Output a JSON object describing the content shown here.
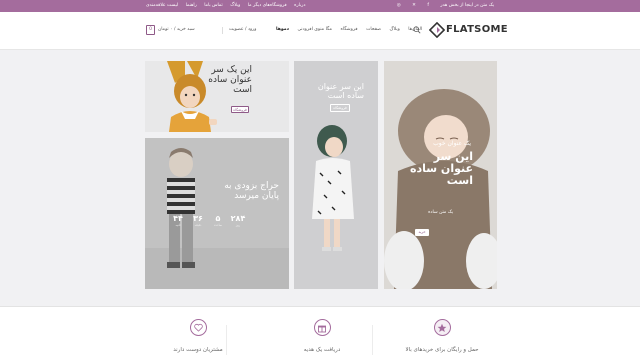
{
  "topbar": {
    "left_items": [
      "درباره",
      "فروشگاه‌های دیگر ما",
      "وبلاگ",
      "تماس باما",
      "راهنما",
      "لیست علاقه‌مندی"
    ],
    "promo": "یک متن در اینجا از بخش هدر"
  },
  "header": {
    "cart_count": "0",
    "cart_label": "سبد خرید / ۰ تومان",
    "login": "ورود / عضویت",
    "nav": [
      "دمو‌ها",
      "مگا منوی افزودنی",
      "فروشگاه",
      "صفحات",
      "وبلاگ",
      "المان‌ها"
    ],
    "logo_text": "FLATSOME"
  },
  "panels": {
    "toy": {
      "title": "این یک سر عنوان ساده است",
      "button": "فروشگاه"
    },
    "boy": {
      "title": "حراج بزودی به پایان میرسد",
      "countdown": [
        {
          "num": "۲۸۴",
          "label": "روز"
        },
        {
          "num": "۵",
          "label": "ساعت"
        },
        {
          "num": "۳۶",
          "label": "دقیقه"
        },
        {
          "num": "۴۴",
          "label": "ثانیه"
        }
      ]
    },
    "hood": {
      "title": "این سر عنوان ساده است",
      "button": "فروشگاه"
    },
    "baby": {
      "eyebrow": "یک عنوان خوب",
      "title": "این سر عنوان ساده است",
      "subtitle": "یک متن ساده",
      "button": "خرید"
    }
  },
  "features": [
    {
      "icon": "heart-icon",
      "label": "مشتریان دوست دارند"
    },
    {
      "icon": "gift-icon",
      "label": "دریافت یک هدیه"
    },
    {
      "icon": "star-icon",
      "label": "حمل و رایگان برای خریدهای بالا"
    }
  ],
  "colors": {
    "brand": "#a46c9d",
    "brand_dark": "#8f5a88"
  }
}
